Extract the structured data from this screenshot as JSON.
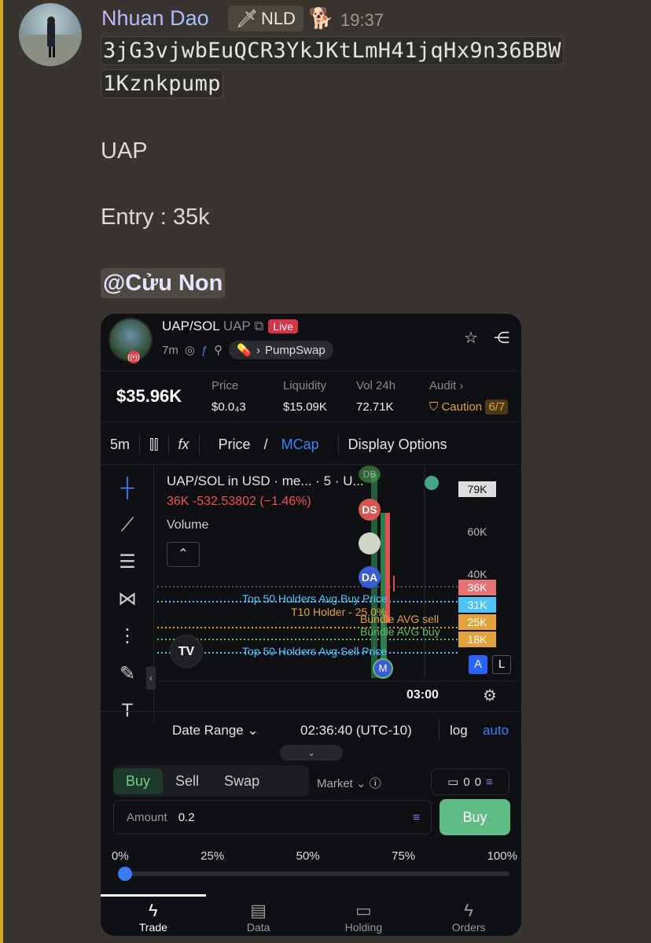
{
  "message": {
    "author": "Nhuan Dao",
    "tag": "NLD",
    "time": "19:37",
    "ca_line1": "3jG3vjwbEuQCR3YkJKtLmH41jqHx9n36BBW",
    "ca_line2": "1Kznkpump",
    "ticker": "UAP",
    "entry": "Entry : 35k",
    "mention": "@Cửu Non"
  },
  "app": {
    "pair": "UAP/SOL",
    "symbol": "UAP",
    "live": "Live",
    "age": "7m",
    "dex": "PumpSwap",
    "mcap": "$35.96K",
    "stats": {
      "price_label": "Price",
      "price_value": "$0.0₄3",
      "liq_label": "Liquidity",
      "liq_value": "$15.09K",
      "vol_label": "Vol 24h",
      "vol_value": "72.71K",
      "audit_label": "Audit",
      "caution": "Caution",
      "audit_score": "6/7"
    },
    "toolbar": {
      "interval": "5m",
      "fx": "fx",
      "price": "Price",
      "mcap": "MCap",
      "display": "Display Options"
    },
    "chart": {
      "title": "UAP/SOL in USD · me... · 5 · U...",
      "price_line": "36K  -532.53802 (−1.46%)",
      "volume": "Volume",
      "levels": [
        "79K",
        "60K",
        "40K",
        "36K",
        "31K",
        "25K",
        "18K"
      ],
      "top50_buy": "Top 50 Holders Avg Buy Price",
      "t10": "T10 Holder - 25.0%",
      "bundle_sell": "Bundle AVG sell",
      "bundle_buy": "Bundle AVG buy",
      "top50_sell": "Top 50 Holders Avg Sell Price",
      "time": "03:00",
      "markers": [
        "DB",
        "DS",
        "DA",
        "M"
      ],
      "btn_a": "A",
      "btn_l": "L"
    },
    "footer": {
      "date_range": "Date Range",
      "clock": "02:36:40 (UTC-10)",
      "log": "log",
      "auto": "auto"
    },
    "trade": {
      "tabs": [
        "Buy",
        "Sell",
        "Swap"
      ],
      "market": "Market",
      "wallet_a": "0",
      "wallet_b": "0",
      "amount_label": "Amount",
      "amount_value": "0.2",
      "buy": "Buy",
      "pcts": [
        "0%",
        "25%",
        "50%",
        "75%",
        "100%"
      ],
      "slider_fraction": 0
    },
    "nav": [
      "Trade",
      "Data",
      "Holding",
      "Orders"
    ]
  }
}
